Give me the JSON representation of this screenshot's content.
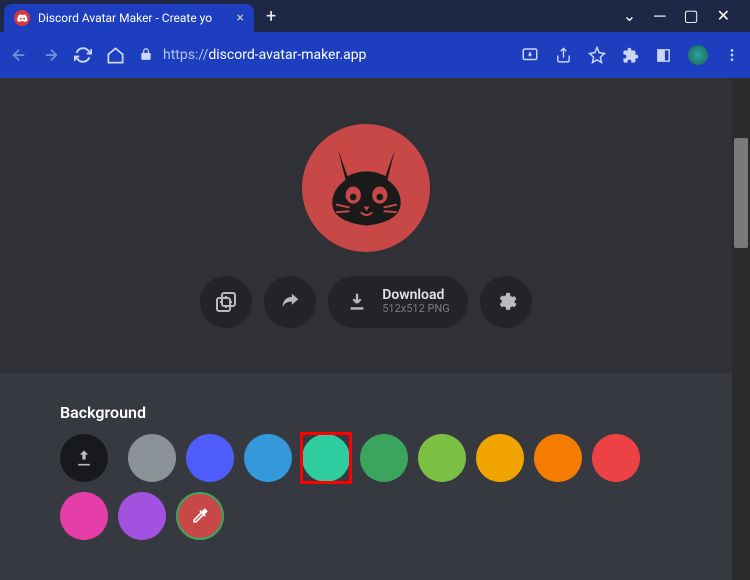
{
  "window": {
    "tab_title": "Discord Avatar Maker - Create yo",
    "url_protocol": "https://",
    "url_host": "discord-avatar-maker.app"
  },
  "actions": {
    "download_label": "Download",
    "download_subtitle": "512x512 PNG"
  },
  "background": {
    "title": "Background",
    "colors": [
      "#8b9297",
      "#4e5dfb",
      "#3498db",
      "#2ecc9f",
      "#3ba55d",
      "#7bc043",
      "#f1a300",
      "#f57c00",
      "#ed4245",
      "#e63ea8",
      "#a352e0"
    ],
    "selected_index": 3,
    "picker_color": "#C84747"
  }
}
